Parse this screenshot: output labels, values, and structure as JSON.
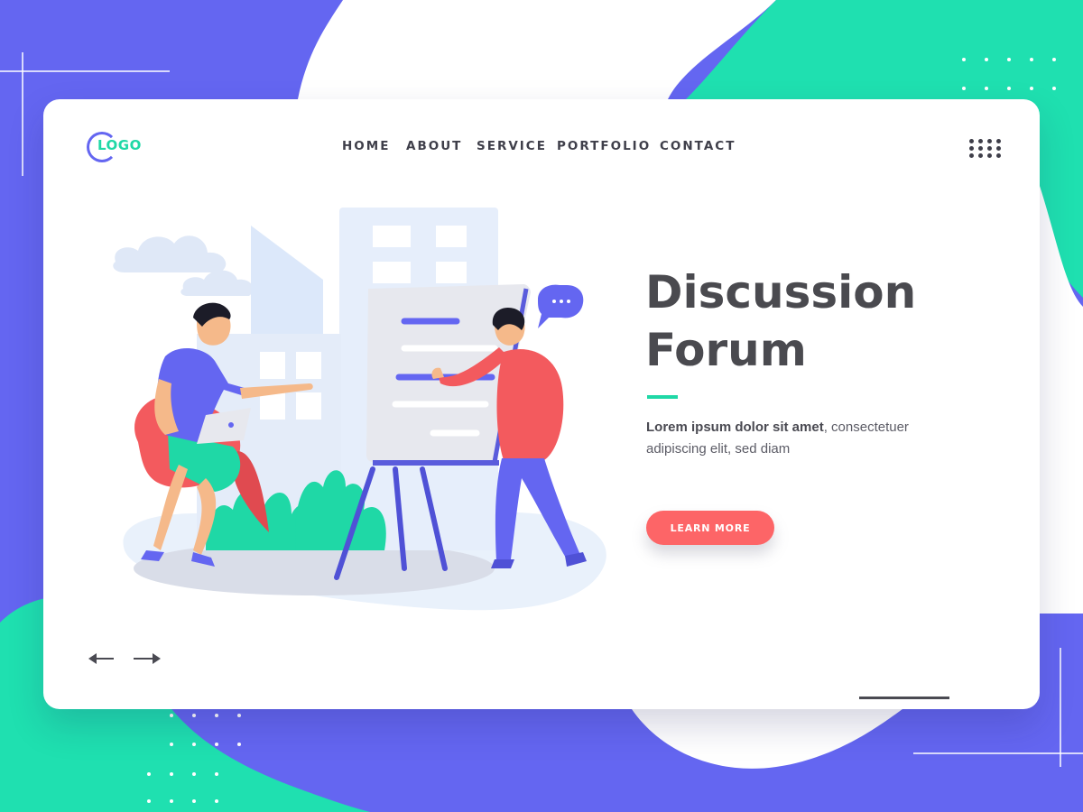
{
  "logo": {
    "text": "LOGO"
  },
  "nav": {
    "items": [
      {
        "label": "HOME"
      },
      {
        "label": "ABOUT"
      },
      {
        "label": "SERVICE"
      },
      {
        "label": "PORTFOLIO"
      },
      {
        "label": "CONTACT"
      }
    ]
  },
  "menu": {
    "icon": "grid-dots-icon"
  },
  "hero": {
    "title_line1": "Discussion",
    "title_line2": "Forum",
    "description_bold": "Lorem ipsum dolor sit amet",
    "description_rest": ", consectetuer adipiscing elit, sed diam",
    "cta_label": "LEARN MORE"
  },
  "controls": {
    "prev_icon": "arrow-left-icon",
    "next_icon": "arrow-right-icon"
  },
  "colors": {
    "primary": "#6466f1",
    "accent": "#1fd8a6",
    "cta": "#fd6567",
    "text_dark": "#4a4a4f"
  }
}
